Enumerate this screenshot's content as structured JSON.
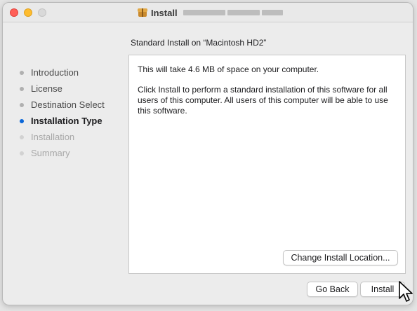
{
  "window": {
    "title": "Install",
    "colors": {
      "close": "#ff5f57",
      "minimize": "#febc2e",
      "zoom": "#d9d9d9",
      "accent": "#0a67d8"
    }
  },
  "header": {
    "subtitle": "Standard Install on “Macintosh HD2”"
  },
  "sidebar": {
    "steps": [
      {
        "label": "Introduction",
        "state": "done"
      },
      {
        "label": "License",
        "state": "done"
      },
      {
        "label": "Destination Select",
        "state": "done"
      },
      {
        "label": "Installation Type",
        "state": "active"
      },
      {
        "label": "Installation",
        "state": "future"
      },
      {
        "label": "Summary",
        "state": "future"
      }
    ]
  },
  "content": {
    "space_text": "This will take 4.6 MB of space on your computer.",
    "description": "Click Install to perform a standard installation of this software for all users of this computer. All users of this computer will be able to use this software.",
    "change_location_label": "Change Install Location..."
  },
  "footer": {
    "back_label": "Go Back",
    "install_label": "Install"
  },
  "icons": {
    "title_icon": "package-icon",
    "cursor": "arrow-cursor-icon"
  }
}
